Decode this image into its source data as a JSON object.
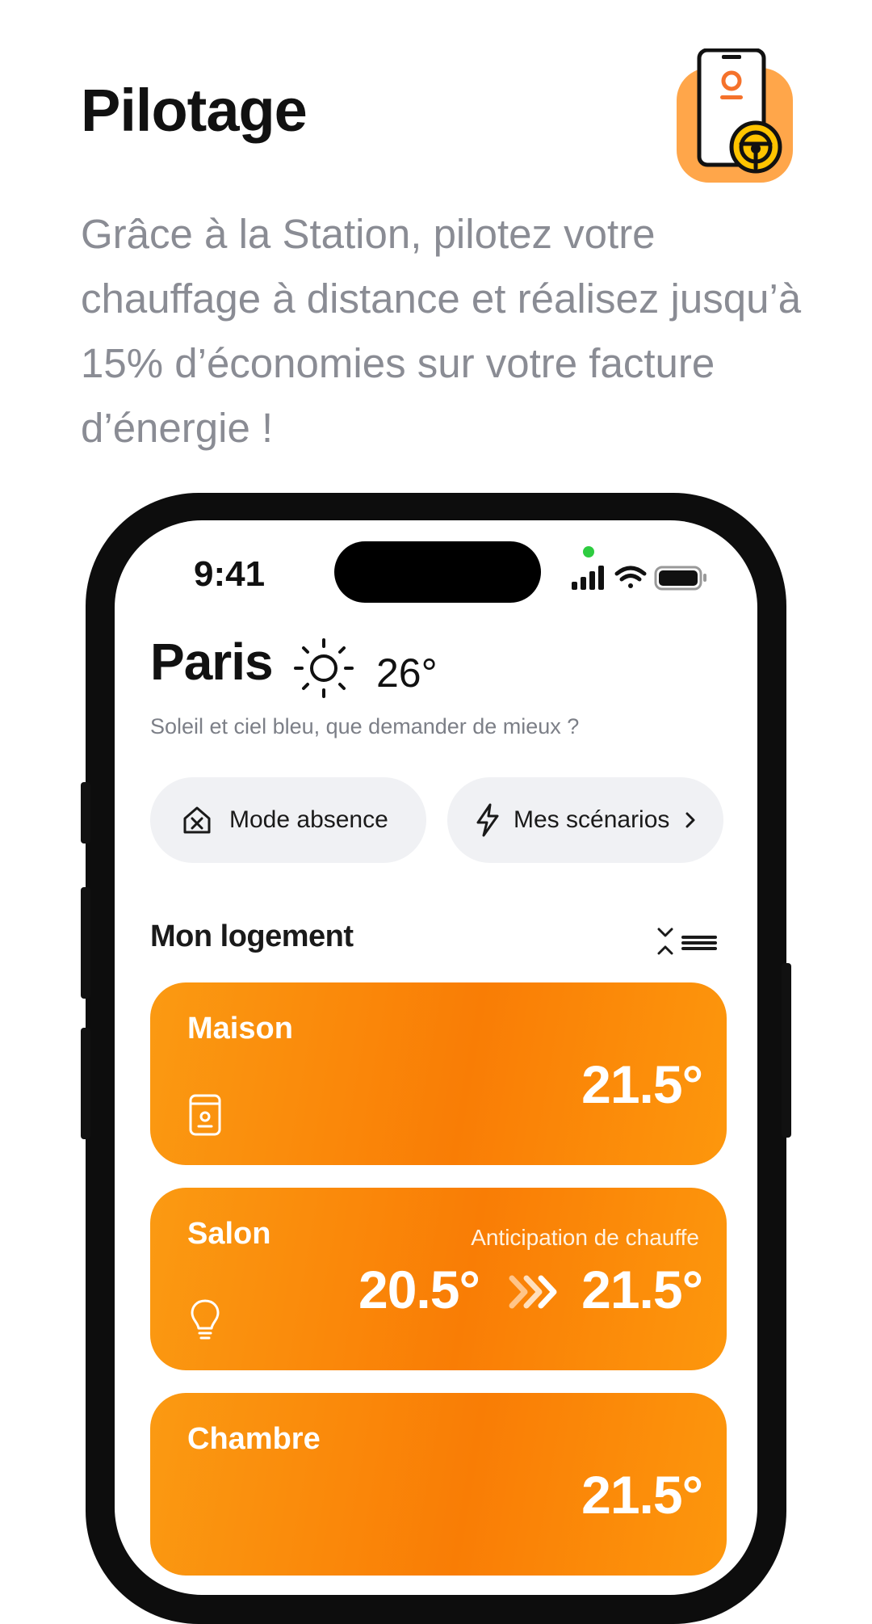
{
  "header": {
    "title": "Pilotage",
    "description": "Grâce à la Station, pilotez votre chauffage à distance et réalisez jusqu’à 15% d’économies sur votre facture d’énergie !"
  },
  "status_bar": {
    "time": "9:41"
  },
  "weather": {
    "city": "Paris",
    "temperature": "26°",
    "description": "Soleil et ciel bleu, que demander de mieux ?",
    "icon": "sun-icon"
  },
  "actions": {
    "absence_label": "Mode absence",
    "scenarios_label": "Mes scénarios"
  },
  "section": {
    "title": "Mon logement"
  },
  "rooms": [
    {
      "name": "Maison",
      "temperature": "21.5°",
      "icon": "thermostat-device-icon"
    },
    {
      "name": "Salon",
      "status": "Anticipation de chauffe",
      "temperature_from": "20.5°",
      "temperature": "21.5°",
      "icon": "lightbulb-icon"
    },
    {
      "name": "Chambre",
      "temperature": "21.5°"
    }
  ],
  "colors": {
    "accent": "#f98a0a",
    "pill_background": "#f0f1f4",
    "text_muted": "#8a8c94"
  }
}
